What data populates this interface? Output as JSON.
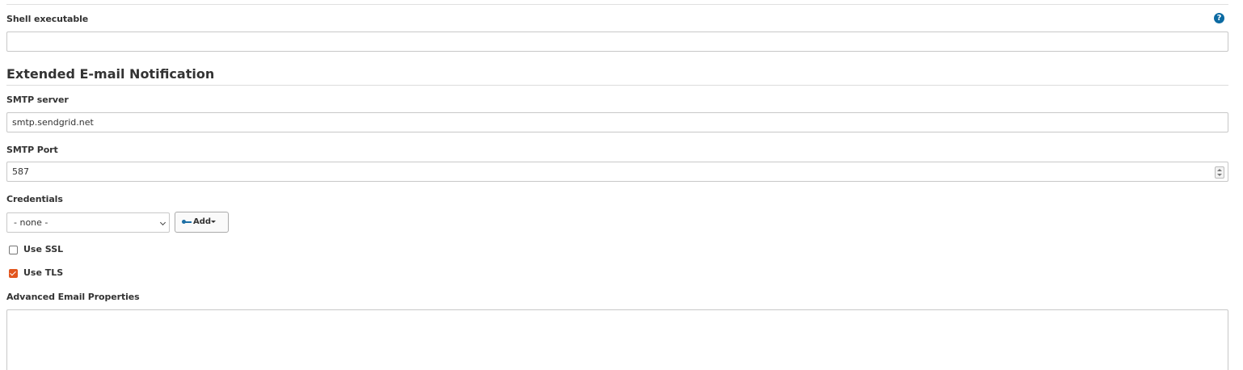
{
  "shell": {
    "label": "Shell executable",
    "help_symbol": "?",
    "value": ""
  },
  "section": {
    "title": "Extended E-mail Notification"
  },
  "smtp_server": {
    "label": "SMTP server",
    "value": "smtp.sendgrid.net"
  },
  "smtp_port": {
    "label": "SMTP Port",
    "value": "587"
  },
  "credentials": {
    "label": "Credentials",
    "selected": "- none -",
    "add_label": "Add"
  },
  "use_ssl": {
    "label": "Use SSL",
    "checked": false
  },
  "use_tls": {
    "label": "Use TLS",
    "checked": true
  },
  "advanced": {
    "label": "Advanced Email Properties",
    "value": ""
  },
  "colors": {
    "accent": "#e2561e",
    "help": "#0b6aa2"
  },
  "icons": [
    "help-icon",
    "key-icon",
    "caret-down-icon",
    "chevron-down-icon",
    "spinner-icon"
  ]
}
